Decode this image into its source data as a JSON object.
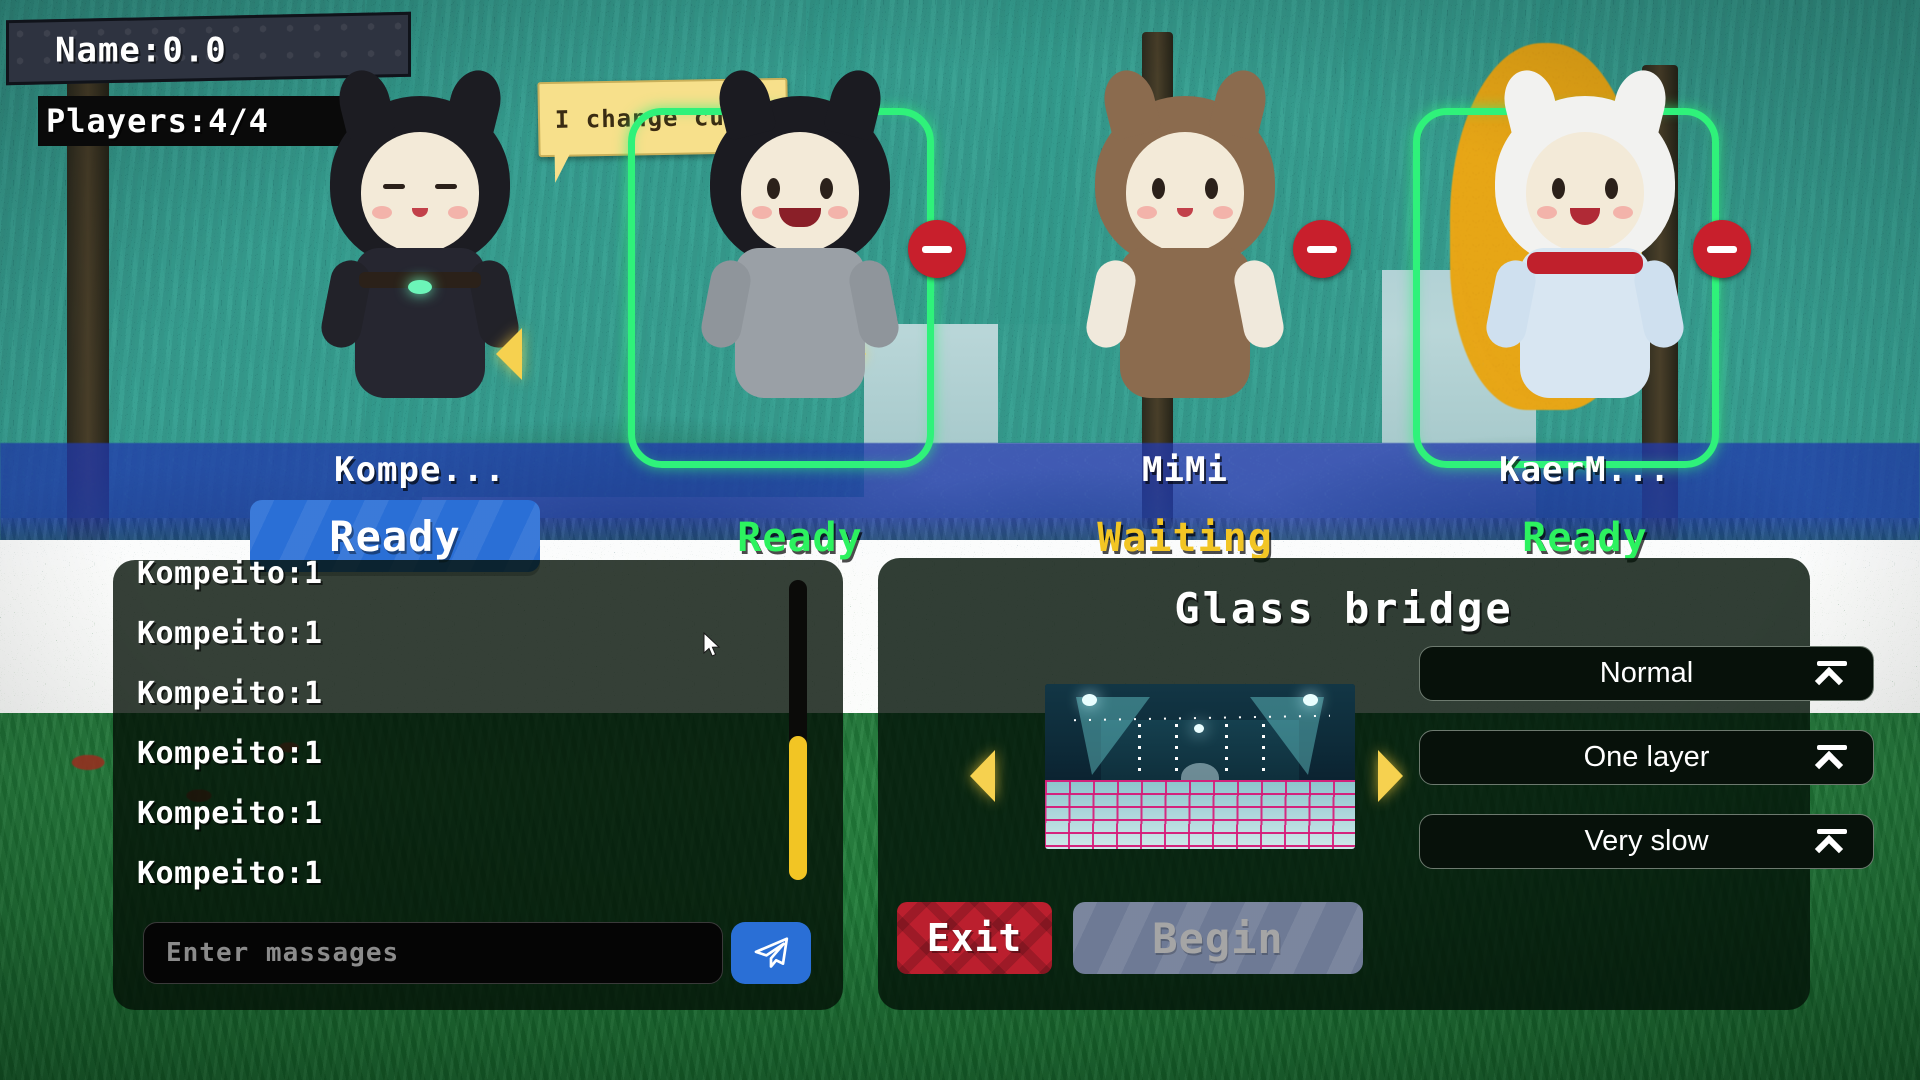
{
  "hud": {
    "name_label": "Name:0.0",
    "players_label": "Players:4/4"
  },
  "speech_bubble": {
    "text": "I change cubes"
  },
  "lobby": {
    "players": [
      {
        "name": "Kompe...",
        "status": "",
        "ready_button": "Ready",
        "is_local": true,
        "selected": false,
        "kickable": false
      },
      {
        "name": "",
        "status": "Ready",
        "is_local": false,
        "selected": true,
        "kickable": true
      },
      {
        "name": "MiMi",
        "status": "Waiting",
        "is_local": false,
        "selected": false,
        "kickable": true
      },
      {
        "name": "KaerM...",
        "status": "Ready",
        "is_local": false,
        "selected": true,
        "kickable": true
      }
    ]
  },
  "chat": {
    "messages": [
      "Kompeito:1",
      "Kompeito:1",
      "Kompeito:1",
      "Kompeito:1",
      "Kompeito:1",
      "Kompeito:1"
    ],
    "input_value": "",
    "input_placeholder": "Enter massages",
    "send_icon": "paper-plane-icon"
  },
  "map_panel": {
    "title": "Glass bridge",
    "preview_alt": "glass-bridge-arena-preview",
    "options": [
      {
        "label": "Normal"
      },
      {
        "label": "One layer"
      },
      {
        "label": "Very slow"
      }
    ],
    "exit_label": "Exit",
    "begin_label": "Begin"
  },
  "colors": {
    "ready_green": "#2cf25f",
    "waiting_yellow": "#f2c524",
    "accent_blue": "#2a6fd6",
    "exit_red": "#bb1f2e",
    "arrow_gold": "#f6d14f",
    "selection_border": "#2ff27a"
  }
}
